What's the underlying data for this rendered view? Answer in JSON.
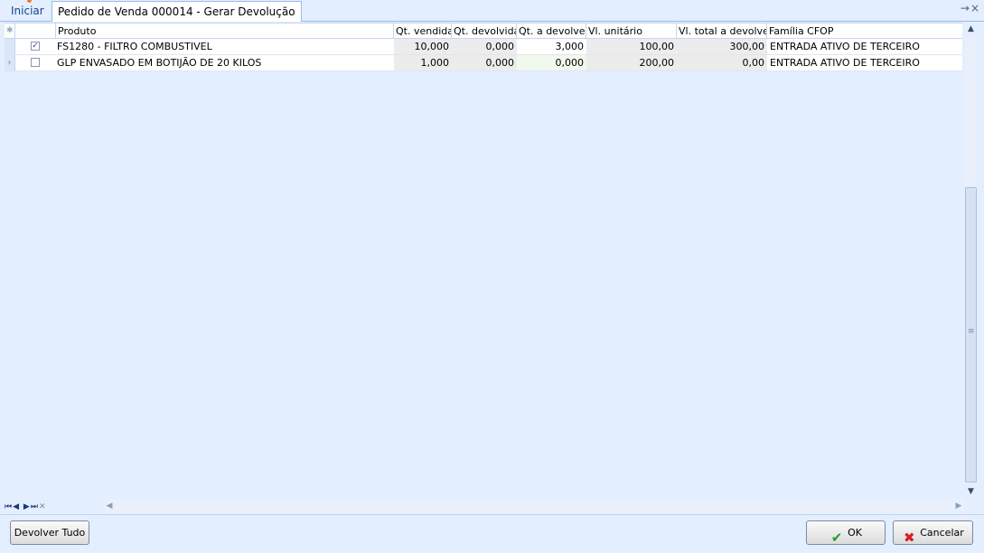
{
  "tabs": [
    {
      "label": "Iniciar",
      "active": false
    },
    {
      "label": "Pedido de Venda 000014 - Gerar Devolução",
      "active": true
    }
  ],
  "window_controls": {
    "pin": "→",
    "close": "×"
  },
  "grid": {
    "columns": [
      "Produto",
      "Qt. vendida",
      "Qt. devolvida",
      "Qt. a devolver",
      "Vl. unitário",
      "Vl. total a devolver",
      "Família CFOP"
    ],
    "rows": [
      {
        "checked": true,
        "produto": "FS1280 - FILTRO COMBUSTIVEL",
        "qt_vendida": "10,000",
        "qt_devolvida": "0,000",
        "qt_a_devolver": "3,000",
        "vl_unitario": "100,00",
        "vl_total": "300,00",
        "familia": "ENTRADA ATIVO DE TERCEIRO",
        "current": false
      },
      {
        "checked": false,
        "produto": "GLP ENVASADO EM BOTIJÃO DE 20 KILOS",
        "qt_vendida": "1,000",
        "qt_devolvida": "0,000",
        "qt_a_devolver": "0,000",
        "vl_unitario": "200,00",
        "vl_total": "0,00",
        "familia": "ENTRADA ATIVO DE TERCEIRO",
        "current": true
      }
    ]
  },
  "navigator": [
    "first-icon",
    "prev-icon",
    "next-icon",
    "last-icon",
    "cancel-icon"
  ],
  "buttons": {
    "devolver_tudo": "Devolver Tudo",
    "ok": "OK",
    "cancelar": "Cancelar"
  },
  "colors": {
    "ok_check": "#2a9a2a",
    "cancel_x": "#d32020",
    "background": "#e3efff"
  }
}
